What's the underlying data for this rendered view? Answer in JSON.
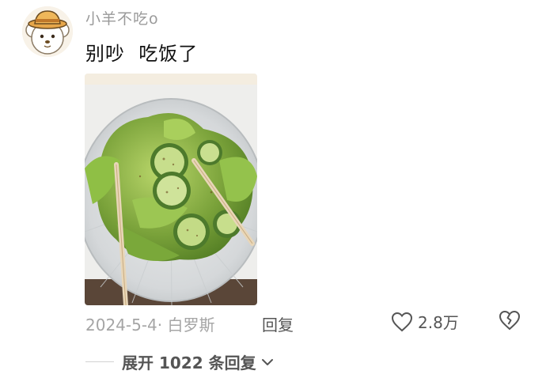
{
  "comment": {
    "username": "小羊不吃o",
    "text": "别吵  吃饭了",
    "date": "2024-5-4",
    "location": "白罗斯",
    "meta_separator": "·",
    "reply_label": "回复",
    "like_count": "2.8万",
    "expand_label": "展开 1022 条回复"
  },
  "icons": {
    "avatar": "cartoon-sheep-avatar",
    "like": "heart-icon",
    "dislike": "broken-heart-icon",
    "expand": "chevron-down-icon"
  },
  "colors": {
    "username": "#9a9a9a",
    "meta": "#a5a5a5",
    "action": "#555555"
  }
}
